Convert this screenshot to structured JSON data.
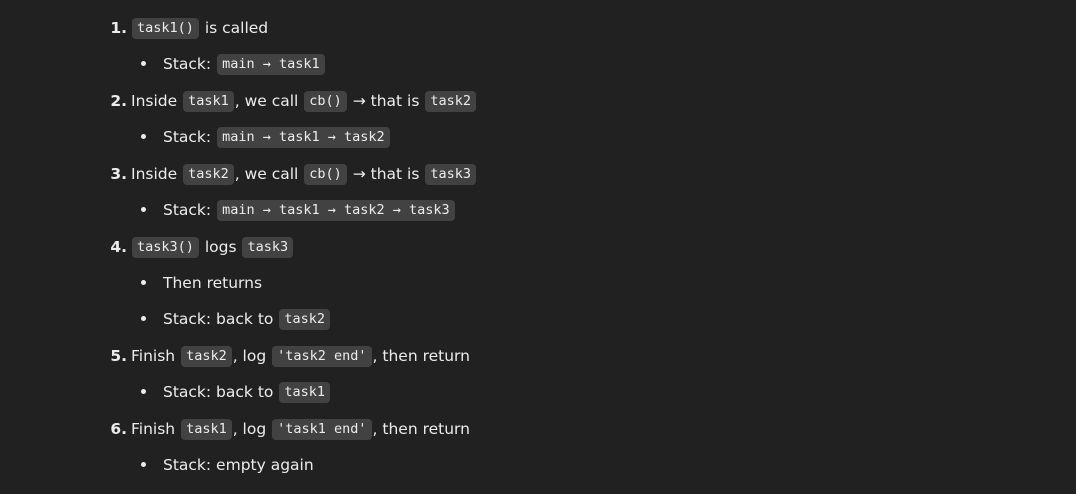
{
  "steps": [
    {
      "number": "1.",
      "parts": [
        "task1()",
        " is called"
      ],
      "sub": [
        {
          "parts": [
            "Stack: ",
            "main → task1"
          ]
        }
      ]
    },
    {
      "number": "2.",
      "parts": [
        "Inside ",
        "task1",
        ", we call ",
        "cb()",
        " → that is ",
        "task2"
      ],
      "sub": [
        {
          "parts": [
            "Stack: ",
            "main → task1 → task2"
          ]
        }
      ]
    },
    {
      "number": "3.",
      "parts": [
        "Inside ",
        "task2",
        ", we call ",
        "cb()",
        " → that is ",
        "task3"
      ],
      "sub": [
        {
          "parts": [
            "Stack: ",
            "main → task1 → task2 → task3"
          ]
        }
      ]
    },
    {
      "number": "4.",
      "parts": [
        "task3()",
        " logs ",
        "task3"
      ],
      "sub": [
        {
          "parts": [
            "Then returns"
          ]
        },
        {
          "parts": [
            "Stack: back to ",
            "task2"
          ]
        }
      ]
    },
    {
      "number": "5.",
      "parts": [
        "Finish ",
        "task2",
        ", log ",
        "'task2 end'",
        ", then return"
      ],
      "sub": [
        {
          "parts": [
            "Stack: back to ",
            "task1"
          ]
        }
      ]
    },
    {
      "number": "6.",
      "parts": [
        "Finish ",
        "task1",
        ", log ",
        "'task1 end'",
        ", then return"
      ],
      "sub": [
        {
          "parts": [
            "Stack: empty again"
          ]
        }
      ]
    }
  ]
}
